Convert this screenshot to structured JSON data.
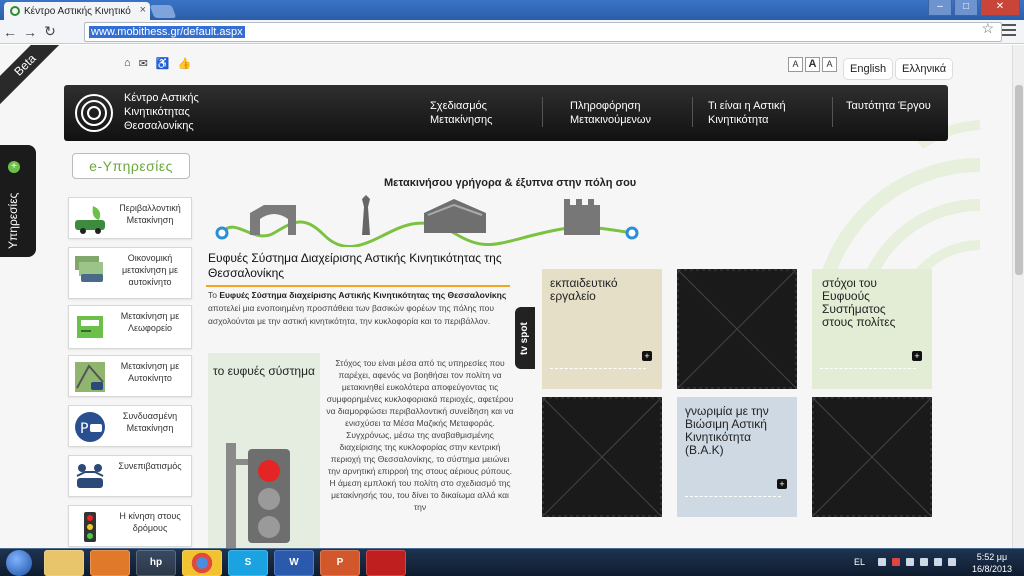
{
  "browser": {
    "tab_title": "Κέντρο Αστικής Κινητικό",
    "tab_close": "×",
    "url": "www.mobithess.gr/default.aspx"
  },
  "page": {
    "beta_label": "Beta",
    "lang_en": "English",
    "lang_el": "Ελληνικά",
    "textsize_buttons": [
      "A",
      "A",
      "A"
    ],
    "brand_name": "Κέντρο Αστικής Κινητικότητας Θεσσαλονίκης",
    "nav": [
      {
        "label": "Σχεδιασμός Μετακίνησης"
      },
      {
        "label": "Πληροφόρηση Μετακινούμενων"
      },
      {
        "label": "Τι είναι η Αστική Κινητικότητα"
      },
      {
        "label": "Ταυτότητα Έργου"
      }
    ],
    "side_tab_label": "Υπηρεσίες",
    "eservices_heading": "e-Υπηρεσίες",
    "services": [
      {
        "label": "Περιβαλλοντική Μετακίνηση",
        "icon": "eco-car-icon"
      },
      {
        "label": "Οικονομική μετακίνηση με αυτοκίνητο",
        "icon": "money-car-icon"
      },
      {
        "label": "Μετακίνηση με Λεωφορείο",
        "icon": "bus-ticket-icon"
      },
      {
        "label": "Μετακίνηση με Αυτοκίνητο",
        "icon": "map-car-icon"
      },
      {
        "label": "Συνδυασμένη Μετακίνηση",
        "icon": "park-and-ride-icon"
      },
      {
        "label": "Συνεπιβατισμός",
        "icon": "carpool-icon"
      },
      {
        "label": "Η κίνηση στους δρόμους",
        "icon": "traffic-light-icon"
      }
    ],
    "tagline": "Μετακινήσου γρήγορα & έξυπνα στην πόλη σου",
    "article_title": "Ευφυές Σύστημα Διαχείρισης Αστικής Κινητικότητας της Θεσσαλονίκης",
    "article_intro_prefix": "Το",
    "article_intro_bold": "Ευφυές Σύστημα διαχείρισης Αστικής Κινητικότητας της Θεσσαλονίκης",
    "article_intro_rest": "αποτελεί μια ενοποιημένη προσπάθεια των βασικών φορέων της πόλης που ασχολούνται με την αστική κινητικότητα, την κυκλοφορία και το περιβάλλον.",
    "feature_title": "το ευφυές σύστημα",
    "feature_body": "Στόχος του είναι μέσα από τις υπηρεσίες που παρέχει, αφενός να βοηθήσει τον πολίτη να μετακινηθεί ευκολότερα αποφεύγοντας τις συμφορημένες κυκλοφοριακά περιοχές, αφετέρου να διαμορφώσει περιβαλλοντική συνείδηση και να ενισχύσει τα Μέσα Μαζικής Μεταφοράς. Συγχρόνως, μέσω της αναβαθμισμένης διαχείρισης της κυκλοφορίας στην κεντρική περιοχή της Θεσσαλονίκης, το σύστημα μειώνει την αρνητική επιρροή της στους αέριους ρύπους. Η άμεση εμπλοκή του πολίτη στο σχεδιασμό της μετακίνησής του, του δίνει το δικαίωμα αλλά και την",
    "tvspot_label": "tv spot",
    "tiles": [
      {
        "title": "εκπαιδευτικό εργαλείο",
        "color": "#e6dfc8"
      },
      {
        "title": "",
        "color": "#1a1a1a"
      },
      {
        "title": "στόχοι του Ευφυούς Συστήματος στους πολίτες",
        "color": "#e3ecd5"
      },
      {
        "title": "",
        "color": "#1a1a1a"
      },
      {
        "title": "γνωριμία με την Βιώσιμη Αστική Κινητικότητα (Β.Α.Κ)",
        "color": "#cfd9e4"
      },
      {
        "title": "",
        "color": "#1a1a1a"
      }
    ],
    "tile_plus": "+"
  },
  "taskbar": {
    "apps": [
      "",
      "",
      "hp",
      "",
      "S",
      "W",
      "P",
      ""
    ],
    "lang": "EL",
    "time": "5:52 μμ",
    "date": "16/8/2013"
  },
  "colors": {
    "accent_green": "#6cc04a",
    "accent_orange": "#f2a623",
    "nav_bg": "#1a1a1a"
  }
}
